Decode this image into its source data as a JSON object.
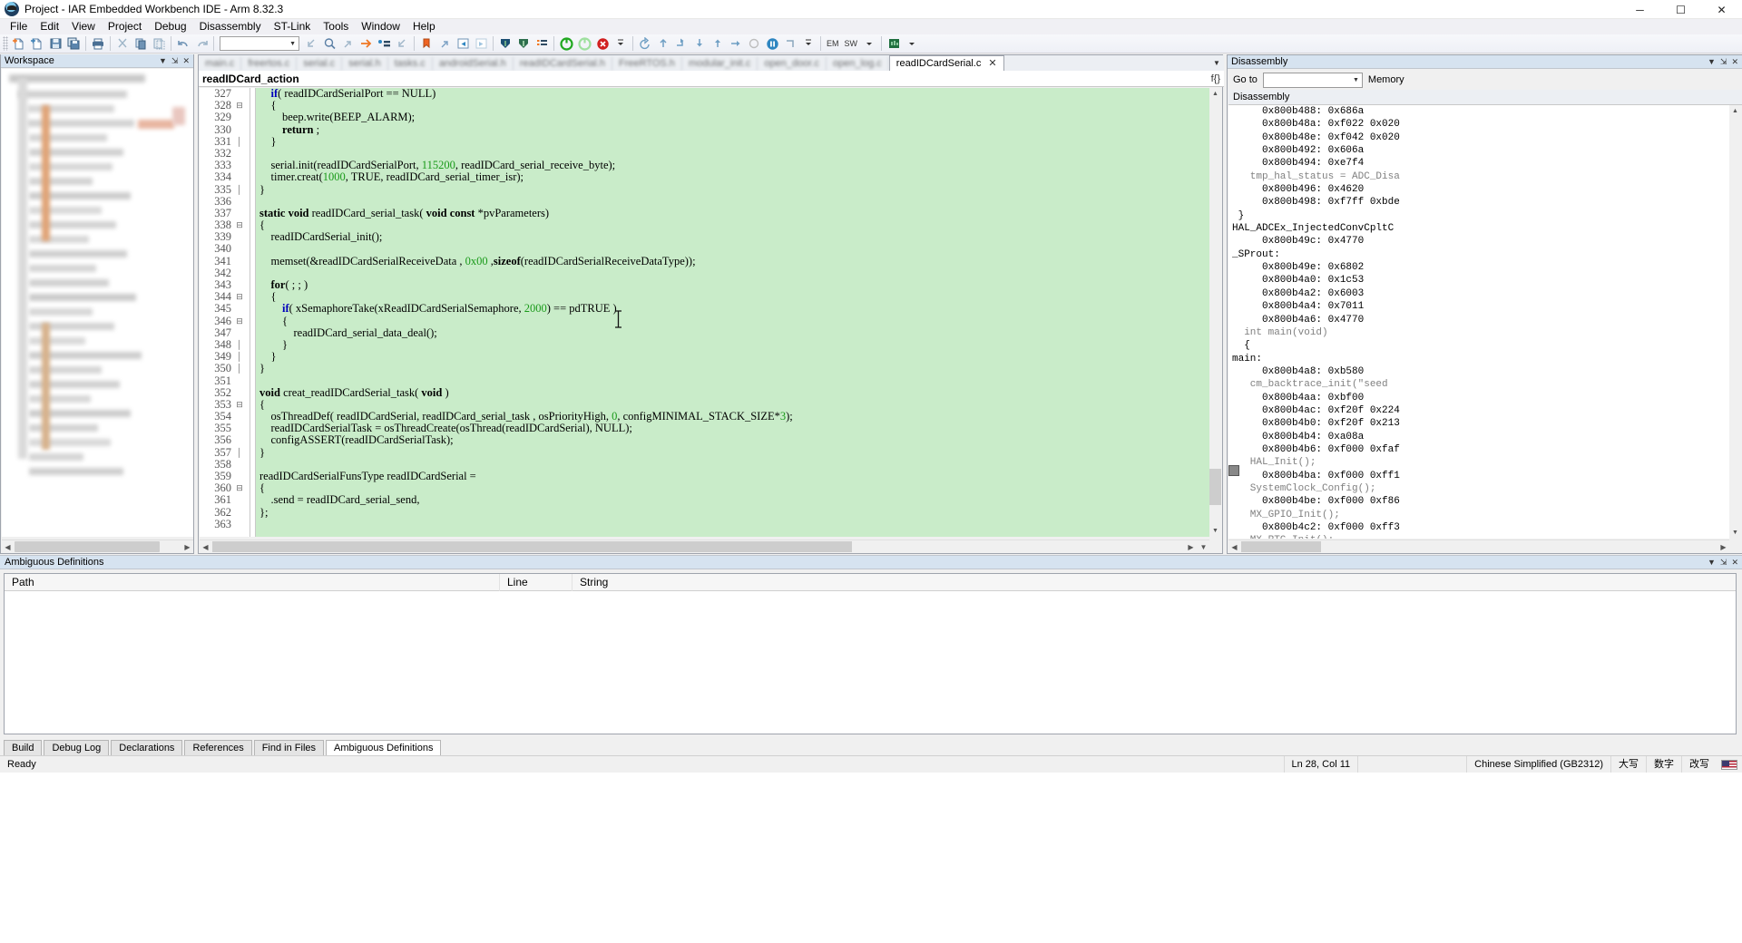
{
  "window": {
    "title": "Project - IAR Embedded Workbench IDE - Arm 8.32.3",
    "minimize": "─",
    "maximize": "☐",
    "close": "✕"
  },
  "menu": {
    "items": [
      "File",
      "Edit",
      "View",
      "Project",
      "Debug",
      "Disassembly",
      "ST-Link",
      "Tools",
      "Window",
      "Help"
    ]
  },
  "toolbar": {
    "combo_value": "",
    "combo_arrow": "▼",
    "em_label": "EM",
    "sw_label": "SW",
    "icons": [
      "new-document-icon",
      "open-document-icon",
      "save-icon",
      "save-all-icon",
      "print-icon",
      "cut-icon",
      "copy-icon",
      "paste-icon",
      "undo-icon",
      "redo-icon",
      "find-previous-icon",
      "find-icon",
      "find-next-icon",
      "find-in-files-icon",
      "toggle-bookmark-icon",
      "previous-bookmark-icon",
      "next-bookmark-icon",
      "go-to-bookmark-icon",
      "compile-icon",
      "make-icon",
      "stop-build-icon",
      "toggle-breakpoint-icon",
      "download-and-debug-icon",
      "debug-without-download-icon",
      "reset-icon",
      "break-icon",
      "stop-debugging-icon",
      "step-over-icon",
      "step-into-icon",
      "step-out-icon",
      "next-statement-icon",
      "run-to-cursor-icon",
      "go-icon",
      "power-log-icon",
      "timeline-icon"
    ]
  },
  "workspace": {
    "title": "Workspace",
    "pin_icon": "⇲",
    "close_icon": "✕",
    "dropdown_icon": "▼",
    "hscroll_left": "◀",
    "hscroll_right": "▶"
  },
  "editor": {
    "tabs": [
      {
        "label": "main.c",
        "active": false
      },
      {
        "label": "freertos.c",
        "active": false
      },
      {
        "label": "serial.c",
        "active": false
      },
      {
        "label": "serial.h",
        "active": false
      },
      {
        "label": "tasks.c",
        "active": false
      },
      {
        "label": "androidSerial.h",
        "active": false
      },
      {
        "label": "readIDCardSerial.h",
        "active": false
      },
      {
        "label": "FreeRTOS.h",
        "active": false
      },
      {
        "label": "modular_init.c",
        "active": false
      },
      {
        "label": "open_door.c",
        "active": false
      },
      {
        "label": "open_log.c",
        "active": false
      },
      {
        "label": "readIDCardSerial.c",
        "active": true,
        "close_icon": "✕"
      }
    ],
    "tab_overflow_icon": "▼",
    "function_name": "readIDCard_action",
    "fn_right_label": "f{}",
    "first_line_number": 327,
    "lines": [
      {
        "n": 327,
        "fold": "",
        "code": "    <span class=\"kw\">if</span><span class=\"plain\">( readIDCardSerialPort == NULL)</span>"
      },
      {
        "n": 328,
        "fold": "⊟",
        "code": "    <span class=\"plain\">{</span>"
      },
      {
        "n": 329,
        "fold": "",
        "code": "        <span class=\"plain\">beep.write(BEEP_ALARM);</span>"
      },
      {
        "n": 330,
        "fold": "",
        "code": "        <span class=\"kw2\">return</span><span class=\"plain\"> ;</span>"
      },
      {
        "n": 331,
        "fold": "│",
        "code": "    <span class=\"plain\">}</span>"
      },
      {
        "n": 332,
        "fold": "",
        "code": ""
      },
      {
        "n": 333,
        "fold": "",
        "code": "    <span class=\"plain\">serial.init(readIDCardSerialPort, </span><span class=\"num\">115200</span><span class=\"plain\">, readIDCard_serial_receive_byte);</span>"
      },
      {
        "n": 334,
        "fold": "",
        "code": "    <span class=\"plain\">timer.creat(</span><span class=\"num\">1000</span><span class=\"plain\">, TRUE, readIDCard_serial_timer_isr);</span>"
      },
      {
        "n": 335,
        "fold": "│",
        "code": "<span class=\"plain\">}</span>"
      },
      {
        "n": 336,
        "fold": "",
        "code": ""
      },
      {
        "n": 337,
        "fold": "",
        "code": "<span class=\"kw2\">static void</span><span class=\"plain\"> readIDCard_serial_task( </span><span class=\"kw2\">void const</span><span class=\"plain\"> *pvParameters)</span>"
      },
      {
        "n": 338,
        "fold": "⊟",
        "code": "<span class=\"plain\">{</span>"
      },
      {
        "n": 339,
        "fold": "",
        "code": "    <span class=\"plain\">readIDCardSerial_init();</span>"
      },
      {
        "n": 340,
        "fold": "",
        "code": ""
      },
      {
        "n": 341,
        "fold": "",
        "code": "    <span class=\"plain\">memset(&amp;readIDCardSerialReceiveData , </span><span class=\"num\">0x00</span><span class=\"plain\"> ,</span><span class=\"kw2\">sizeof</span><span class=\"plain\">(readIDCardSerialReceiveDataType));</span>"
      },
      {
        "n": 342,
        "fold": "",
        "code": ""
      },
      {
        "n": 343,
        "fold": "",
        "code": "    <span class=\"kw2\">for</span><span class=\"plain\">( ; ; )</span>"
      },
      {
        "n": 344,
        "fold": "⊟",
        "code": "    <span class=\"plain\">{</span>"
      },
      {
        "n": 345,
        "fold": "",
        "code": "        <span class=\"kw\">if</span><span class=\"plain\">( xSemaphoreTake(xReadIDCardSerialSemaphore, </span><span class=\"num\">2000</span><span class=\"plain\">) == pdTRUE )</span>"
      },
      {
        "n": 346,
        "fold": "⊟",
        "code": "        <span class=\"plain\">{</span>"
      },
      {
        "n": 347,
        "fold": "",
        "code": "            <span class=\"plain\">readIDCard_serial_data_deal();</span>"
      },
      {
        "n": 348,
        "fold": "│",
        "code": "        <span class=\"plain\">}</span>"
      },
      {
        "n": 349,
        "fold": "│",
        "code": "    <span class=\"plain\">}</span>"
      },
      {
        "n": 350,
        "fold": "│",
        "code": "<span class=\"plain\">}</span>"
      },
      {
        "n": 351,
        "fold": "",
        "code": ""
      },
      {
        "n": 352,
        "fold": "",
        "code": "<span class=\"kw2\">void</span><span class=\"plain\"> creat_readIDCardSerial_task( </span><span class=\"kw2\">void</span><span class=\"plain\"> )</span>"
      },
      {
        "n": 353,
        "fold": "⊟",
        "code": "<span class=\"plain\">{</span>"
      },
      {
        "n": 354,
        "fold": "",
        "code": "    <span class=\"plain\">osThreadDef( readIDCardSerial, readIDCard_serial_task , osPriorityHigh, </span><span class=\"num\">0</span><span class=\"plain\">, configMINIMAL_STACK_SIZE*</span><span class=\"num\">3</span><span class=\"plain\">);</span>"
      },
      {
        "n": 355,
        "fold": "",
        "code": "    <span class=\"plain\">readIDCardSerialTask = osThreadCreate(osThread(readIDCardSerial), NULL);</span>"
      },
      {
        "n": 356,
        "fold": "",
        "code": "    <span class=\"plain\">configASSERT(readIDCardSerialTask);</span>"
      },
      {
        "n": 357,
        "fold": "│",
        "code": "<span class=\"plain\">}</span>"
      },
      {
        "n": 358,
        "fold": "",
        "code": ""
      },
      {
        "n": 359,
        "fold": "",
        "code": "<span class=\"plain\">readIDCardSerialFunsType readIDCardSerial =</span>"
      },
      {
        "n": 360,
        "fold": "⊟",
        "code": "<span class=\"plain\">{</span>"
      },
      {
        "n": 361,
        "fold": "",
        "code": "    <span class=\"plain\">.send = readIDCard_serial_send,</span>"
      },
      {
        "n": 362,
        "fold": "",
        "code": "<span class=\"plain\">};</span>"
      },
      {
        "n": 363,
        "fold": "",
        "code": ""
      }
    ],
    "scroll_up_icon": "▲",
    "scroll_down_icon": "▼",
    "scroll_left_icon": "◀",
    "scroll_right_icon": "▶"
  },
  "disassembly": {
    "title": "Disassembly",
    "pin_icon": "⇲",
    "close_icon": "✕",
    "dropdown_icon": "▼",
    "goto_label": "Go to",
    "goto_value": "",
    "goto_arrow": "▼",
    "memory_label": "Memory",
    "list_header": "Disassembly",
    "rows": [
      {
        "kind": "code",
        "text": "     0x800b488: 0x686a"
      },
      {
        "kind": "code",
        "text": "     0x800b48a: 0xf022 0x020"
      },
      {
        "kind": "code",
        "text": "     0x800b48e: 0xf042 0x020"
      },
      {
        "kind": "code",
        "text": "     0x800b492: 0x606a"
      },
      {
        "kind": "code",
        "text": "     0x800b494: 0xe7f4"
      },
      {
        "kind": "src",
        "text": "   tmp_hal_status = ADC_Disa"
      },
      {
        "kind": "code",
        "text": "     0x800b496: 0x4620"
      },
      {
        "kind": "code",
        "text": "     0x800b498: 0xf7ff 0xbde"
      },
      {
        "kind": "lbl",
        "text": " }"
      },
      {
        "kind": "lbl",
        "text": "HAL_ADCEx_InjectedConvCpltC"
      },
      {
        "kind": "code",
        "text": "     0x800b49c: 0x4770"
      },
      {
        "kind": "lbl",
        "text": "_SProut:"
      },
      {
        "kind": "code",
        "text": "     0x800b49e: 0x6802"
      },
      {
        "kind": "code",
        "text": "     0x800b4a0: 0x1c53"
      },
      {
        "kind": "code",
        "text": "     0x800b4a2: 0x6003"
      },
      {
        "kind": "code",
        "text": "     0x800b4a4: 0x7011"
      },
      {
        "kind": "code",
        "text": "     0x800b4a6: 0x4770"
      },
      {
        "kind": "src",
        "text": "  int main(void)"
      },
      {
        "kind": "lbl",
        "text": "  {"
      },
      {
        "kind": "lbl",
        "text": "main:"
      },
      {
        "kind": "code",
        "text": "     0x800b4a8: 0xb580"
      },
      {
        "kind": "src",
        "text": "   cm_backtrace_init(\"seed"
      },
      {
        "kind": "code",
        "text": "     0x800b4aa: 0xbf00"
      },
      {
        "kind": "code",
        "text": "     0x800b4ac: 0xf20f 0x224"
      },
      {
        "kind": "code",
        "text": "     0x800b4b0: 0xf20f 0x213"
      },
      {
        "kind": "code",
        "text": "     0x800b4b4: 0xa08a"
      },
      {
        "kind": "code",
        "text": "     0x800b4b6: 0xf000 0xfaf"
      },
      {
        "kind": "src",
        "text": "   HAL_Init();"
      },
      {
        "kind": "code",
        "text": "     0x800b4ba: 0xf000 0xff1"
      },
      {
        "kind": "src",
        "text": "   SystemClock_Config();"
      },
      {
        "kind": "code",
        "text": "     0x800b4be: 0xf000 0xf86"
      },
      {
        "kind": "src",
        "text": "   MX_GPIO_Init();"
      },
      {
        "kind": "code",
        "text": "     0x800b4c2: 0xf000 0xff3"
      },
      {
        "kind": "src",
        "text": "   MX_RTC_Init();"
      }
    ],
    "scroll_up_icon": "▲",
    "scroll_down_icon": "▼",
    "scroll_left_icon": "◀",
    "scroll_right_icon": "▶"
  },
  "bottom_panel": {
    "title": "Ambiguous Definitions",
    "pin_icon": "⇲",
    "close_icon": "✕",
    "dropdown_icon": "▼",
    "columns": [
      "Path",
      "Line",
      "String"
    ],
    "rows": []
  },
  "bottom_tabs": {
    "items": [
      "Build",
      "Debug Log",
      "Declarations",
      "References",
      "Find in Files",
      "Ambiguous Definitions"
    ],
    "active": "Ambiguous Definitions"
  },
  "statusbar": {
    "message": "Ready",
    "cursor_position": "Ln 28, Col 11",
    "ime_language": "Chinese Simplified (GB2312)",
    "ime_items": [
      "大写",
      "数字",
      "改写"
    ]
  },
  "colors": {
    "editor_background": "#c9ecc9",
    "panel_header": "#d6e3f0",
    "keyword": "#0000bb",
    "number": "#1a9a1a",
    "chrome": "#f0f0f0",
    "accent_orange": "#ef7622",
    "accent_green": "#20a020",
    "accent_red": "#d12020"
  }
}
